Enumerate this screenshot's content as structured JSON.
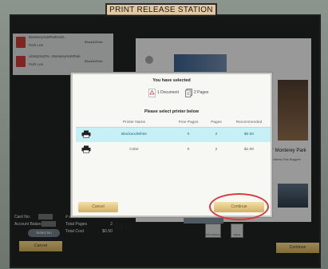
{
  "header": {
    "station_label": "PRINT RELEASE STATION"
  },
  "background": {
    "doc_list": [
      {
        "line1": "Monterey%20Park%20...",
        "line2": "Ruth Lew",
        "right": "Black&White"
      },
      {
        "line1": "Library%20%...Monterey%20Park",
        "line2": "Ruth Lew",
        "right": "Black&White"
      }
    ],
    "preview": {
      "side_title": "for Monterey Park",
      "side_sub": "of Monterey Park Bloggertv"
    },
    "info": {
      "card_label": "Card No:",
      "balance_label": "Account Balance:",
      "select_button": "Select No",
      "documents_label": "# of Documents",
      "documents_value": "1",
      "pages_label": "Total Pages",
      "pages_value": "2",
      "cost_label": "Total Cost",
      "cost_value": "$0.50",
      "watermark_top": "MC",
      "watermark_bottom": "3RU"
    },
    "tool1": "Print Options",
    "tool2": "Delete",
    "cancel_button": "Cancel",
    "continue_button": "Continue"
  },
  "modal": {
    "title": "You have selected",
    "documents_text": "1 Document",
    "pages_text": "2 Pages",
    "select_prompt": "Please select printer below",
    "columns": [
      "",
      "Printer Name",
      "Free Pages",
      "Pages",
      "Recommended"
    ],
    "printers": [
      {
        "name": "BlackandWhite",
        "free_pages": "0",
        "pages": "2",
        "cost": "$0.50",
        "selected": true
      },
      {
        "name": "Color",
        "free_pages": "0",
        "pages": "2",
        "cost": "$1.00",
        "selected": false
      }
    ],
    "cancel_button": "Cancel",
    "continue_button": "Continue"
  },
  "colors": {
    "accent_gold": "#d1b066",
    "selected_row": "#c6eff6",
    "highlight_circle": "#d93a3a"
  }
}
